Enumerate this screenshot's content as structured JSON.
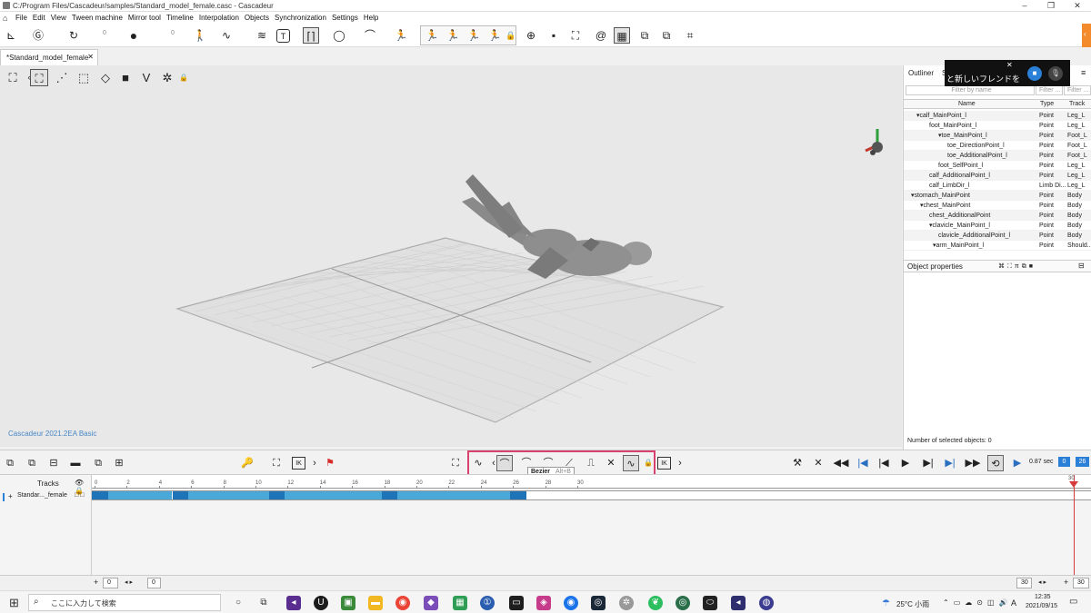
{
  "window": {
    "title": "C:/Program Files/Cascadeur/samples/Standard_model_female.casc - Cascadeur"
  },
  "menu": [
    "File",
    "Edit",
    "View",
    "Tween machine",
    "Mirror tool",
    "Timeline",
    "Interpolation",
    "Objects",
    "Synchronization",
    "Settings",
    "Help"
  ],
  "toolbar": {
    "num_a": "0",
    "num_b": "0"
  },
  "doc_tab": "*Standard_model_female",
  "viewport": {
    "version": "Cascadeur 2021.2EA Basic"
  },
  "panel": {
    "tab_outliner": "Outliner",
    "tab_s": "S",
    "popup_text": "と新しいフレンドを",
    "filter_name": "Filter by name",
    "filter_type": "Filter ...",
    "filter_track": "Filter ...",
    "col_name": "Name",
    "col_type": "Type",
    "col_track": "Track",
    "rows": [
      {
        "name": "▾calf_MainPoint_l",
        "type": "Point",
        "track": "Leg_L"
      },
      {
        "name": "foot_MainPoint_l",
        "type": "Point",
        "track": "Leg_L"
      },
      {
        "name": "▾toe_MainPoint_l",
        "type": "Point",
        "track": "Foot_L"
      },
      {
        "name": "toe_DirectionPoint_l",
        "type": "Point",
        "track": "Foot_L"
      },
      {
        "name": "toe_AdditionalPoint_l",
        "type": "Point",
        "track": "Foot_L"
      },
      {
        "name": "foot_SelfPoint_l",
        "type": "Point",
        "track": "Leg_L"
      },
      {
        "name": "calf_AdditionalPoint_l",
        "type": "Point",
        "track": "Leg_L"
      },
      {
        "name": "calf_LimbDir_l",
        "type": "Limb Di...",
        "track": "Leg_L"
      },
      {
        "name": "▾stomach_MainPoint",
        "type": "Point",
        "track": "Body"
      },
      {
        "name": "▾chest_MainPoint",
        "type": "Point",
        "track": "Body"
      },
      {
        "name": "chest_AdditionalPoint",
        "type": "Point",
        "track": "Body"
      },
      {
        "name": "▾clavicle_MainPoint_l",
        "type": "Point",
        "track": "Body"
      },
      {
        "name": "clavicle_AdditionalPoint_l",
        "type": "Point",
        "track": "Body"
      },
      {
        "name": "▾arm_MainPoint_l",
        "type": "Point",
        "track": "Should..."
      }
    ],
    "obj_props": "Object properties",
    "selected_count": "Number of selected objects: 0"
  },
  "timeline": {
    "tooltip_title": "Bezier",
    "tooltip_key": "Alt+B",
    "time": "0.87 sec",
    "frame_a": "0",
    "frame_b": "26",
    "tracks_label": "Tracks",
    "track_name": "Standar..._female",
    "ticks": [
      "0",
      "2",
      "4",
      "6",
      "8",
      "10",
      "12",
      "14",
      "16",
      "18",
      "20",
      "22",
      "24",
      "26",
      "28",
      "30"
    ],
    "end_frame": "30",
    "start_a": "0",
    "start_b": "0",
    "end_a": "30",
    "end_b": "30"
  },
  "taskbar": {
    "search_placeholder": "ここに入力して検索",
    "weather": "25°C 小雨",
    "ime": "A",
    "time": "12:35",
    "date": "2021/09/15"
  },
  "colors": {
    "accent": "#f38b2c",
    "segment_dark": "#1f73b7",
    "segment_light": "#4aa8d8",
    "highlight": "#d9426e"
  }
}
